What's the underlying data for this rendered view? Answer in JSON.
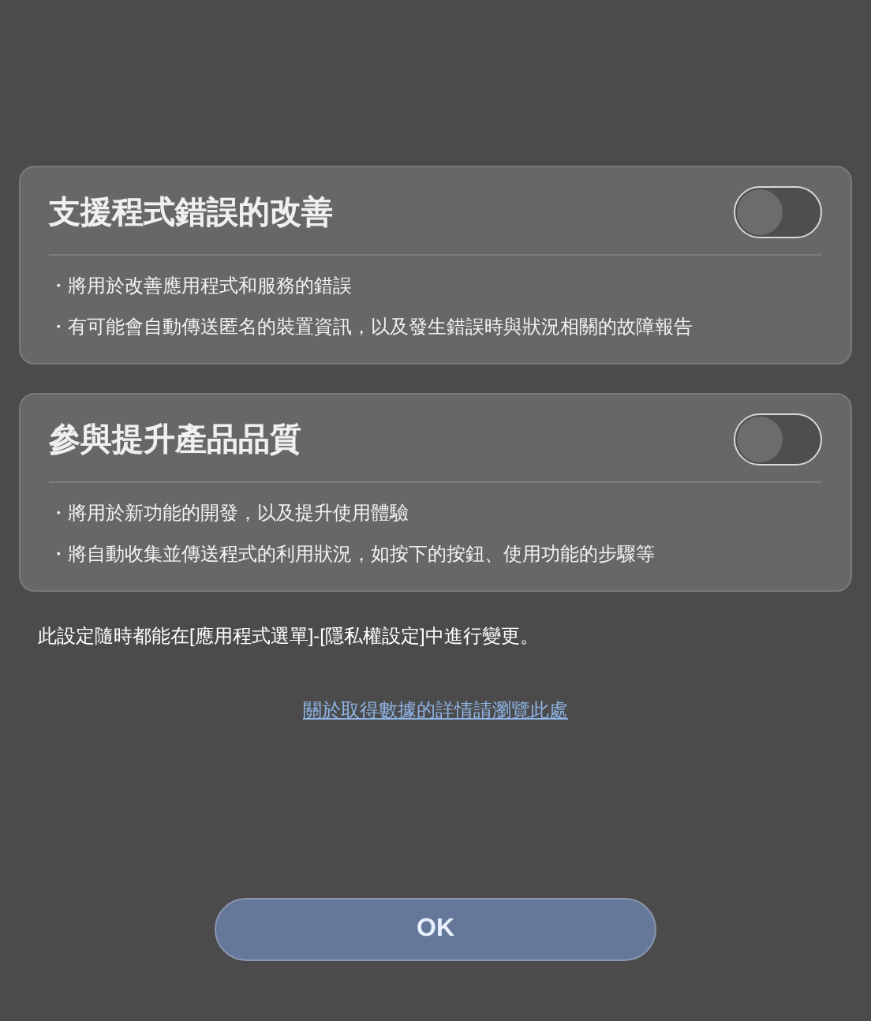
{
  "sections": [
    {
      "title": "支援程式錯誤的改善",
      "on": false,
      "bullets": [
        "・將用於改善應用程式和服務的錯誤",
        "・有可能會自動傳送匿名的裝置資訊，以及發生錯誤時與狀況相關的故障報告"
      ]
    },
    {
      "title": "參與提升產品品質",
      "on": false,
      "bullets": [
        "・將用於新功能的開發，以及提升使用體驗",
        "・將自動收集並傳送程式的利用狀況，如按下的按鈕、使用功能的步驟等"
      ]
    }
  ],
  "note": "此設定隨時都能在[應用程式選單]-[隱私權設定]中進行變更。",
  "link": "關於取得數據的詳情請瀏覽此處",
  "button": "OK"
}
